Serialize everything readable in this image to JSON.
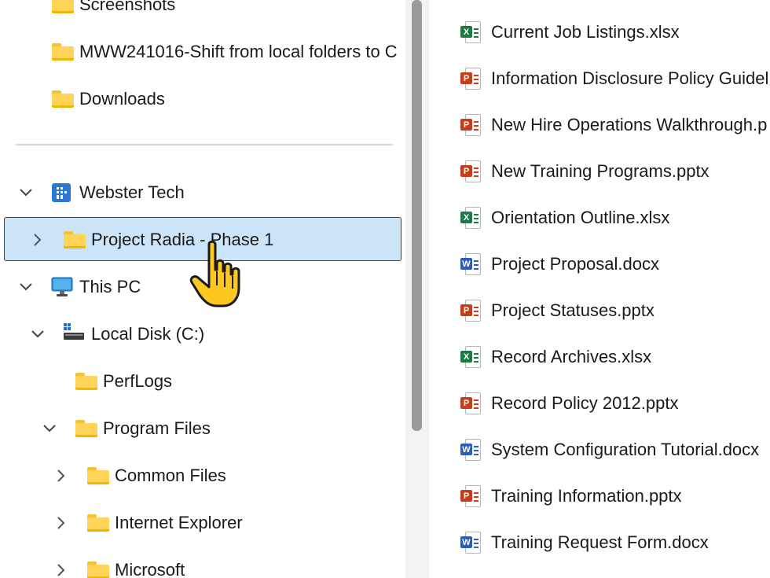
{
  "nav": {
    "items": [
      {
        "label": "Screenshots",
        "type": "folder"
      },
      {
        "label": "MWW241016-Shift from local folders to C",
        "type": "folder"
      },
      {
        "label": "Downloads",
        "type": "folder"
      },
      {
        "label": "Webster Tech",
        "type": "org",
        "expanded": true
      },
      {
        "label": "Project Radia - Phase 1",
        "type": "folder",
        "selected": true
      },
      {
        "label": "This PC",
        "type": "pc",
        "expanded": true
      },
      {
        "label": "Local Disk (C:)",
        "type": "drive",
        "expanded": true
      },
      {
        "label": "PerfLogs",
        "type": "folder"
      },
      {
        "label": "Program Files",
        "type": "folder",
        "expanded": true
      },
      {
        "label": "Common Files",
        "type": "folder"
      },
      {
        "label": "Internet Explorer",
        "type": "folder"
      },
      {
        "label": "Microsoft",
        "type": "folder"
      }
    ]
  },
  "files": [
    {
      "name": "Current Job Listings.xlsx",
      "kind": "excel"
    },
    {
      "name": "Information Disclosure Policy Guidel",
      "kind": "powerpoint"
    },
    {
      "name": "New Hire Operations Walkthrough.p",
      "kind": "powerpoint"
    },
    {
      "name": "New Training Programs.pptx",
      "kind": "powerpoint"
    },
    {
      "name": "Orientation Outline.xlsx",
      "kind": "excel"
    },
    {
      "name": "Project Proposal.docx",
      "kind": "word"
    },
    {
      "name": "Project Statuses.pptx",
      "kind": "powerpoint"
    },
    {
      "name": "Record Archives.xlsx",
      "kind": "excel"
    },
    {
      "name": "Record Policy 2012.pptx",
      "kind": "powerpoint"
    },
    {
      "name": "System Configuration Tutorial.docx",
      "kind": "word"
    },
    {
      "name": "Training Information.pptx",
      "kind": "powerpoint"
    },
    {
      "name": "Training Request Form.docx",
      "kind": "word"
    }
  ],
  "icons": {
    "excel": {
      "letter": "X",
      "color": "#1d7a45"
    },
    "powerpoint": {
      "letter": "P",
      "color": "#c43e1c"
    },
    "word": {
      "letter": "W",
      "color": "#2b5cb8"
    },
    "folder": "folder-icon",
    "cursor": "hand-pointer-icon"
  }
}
